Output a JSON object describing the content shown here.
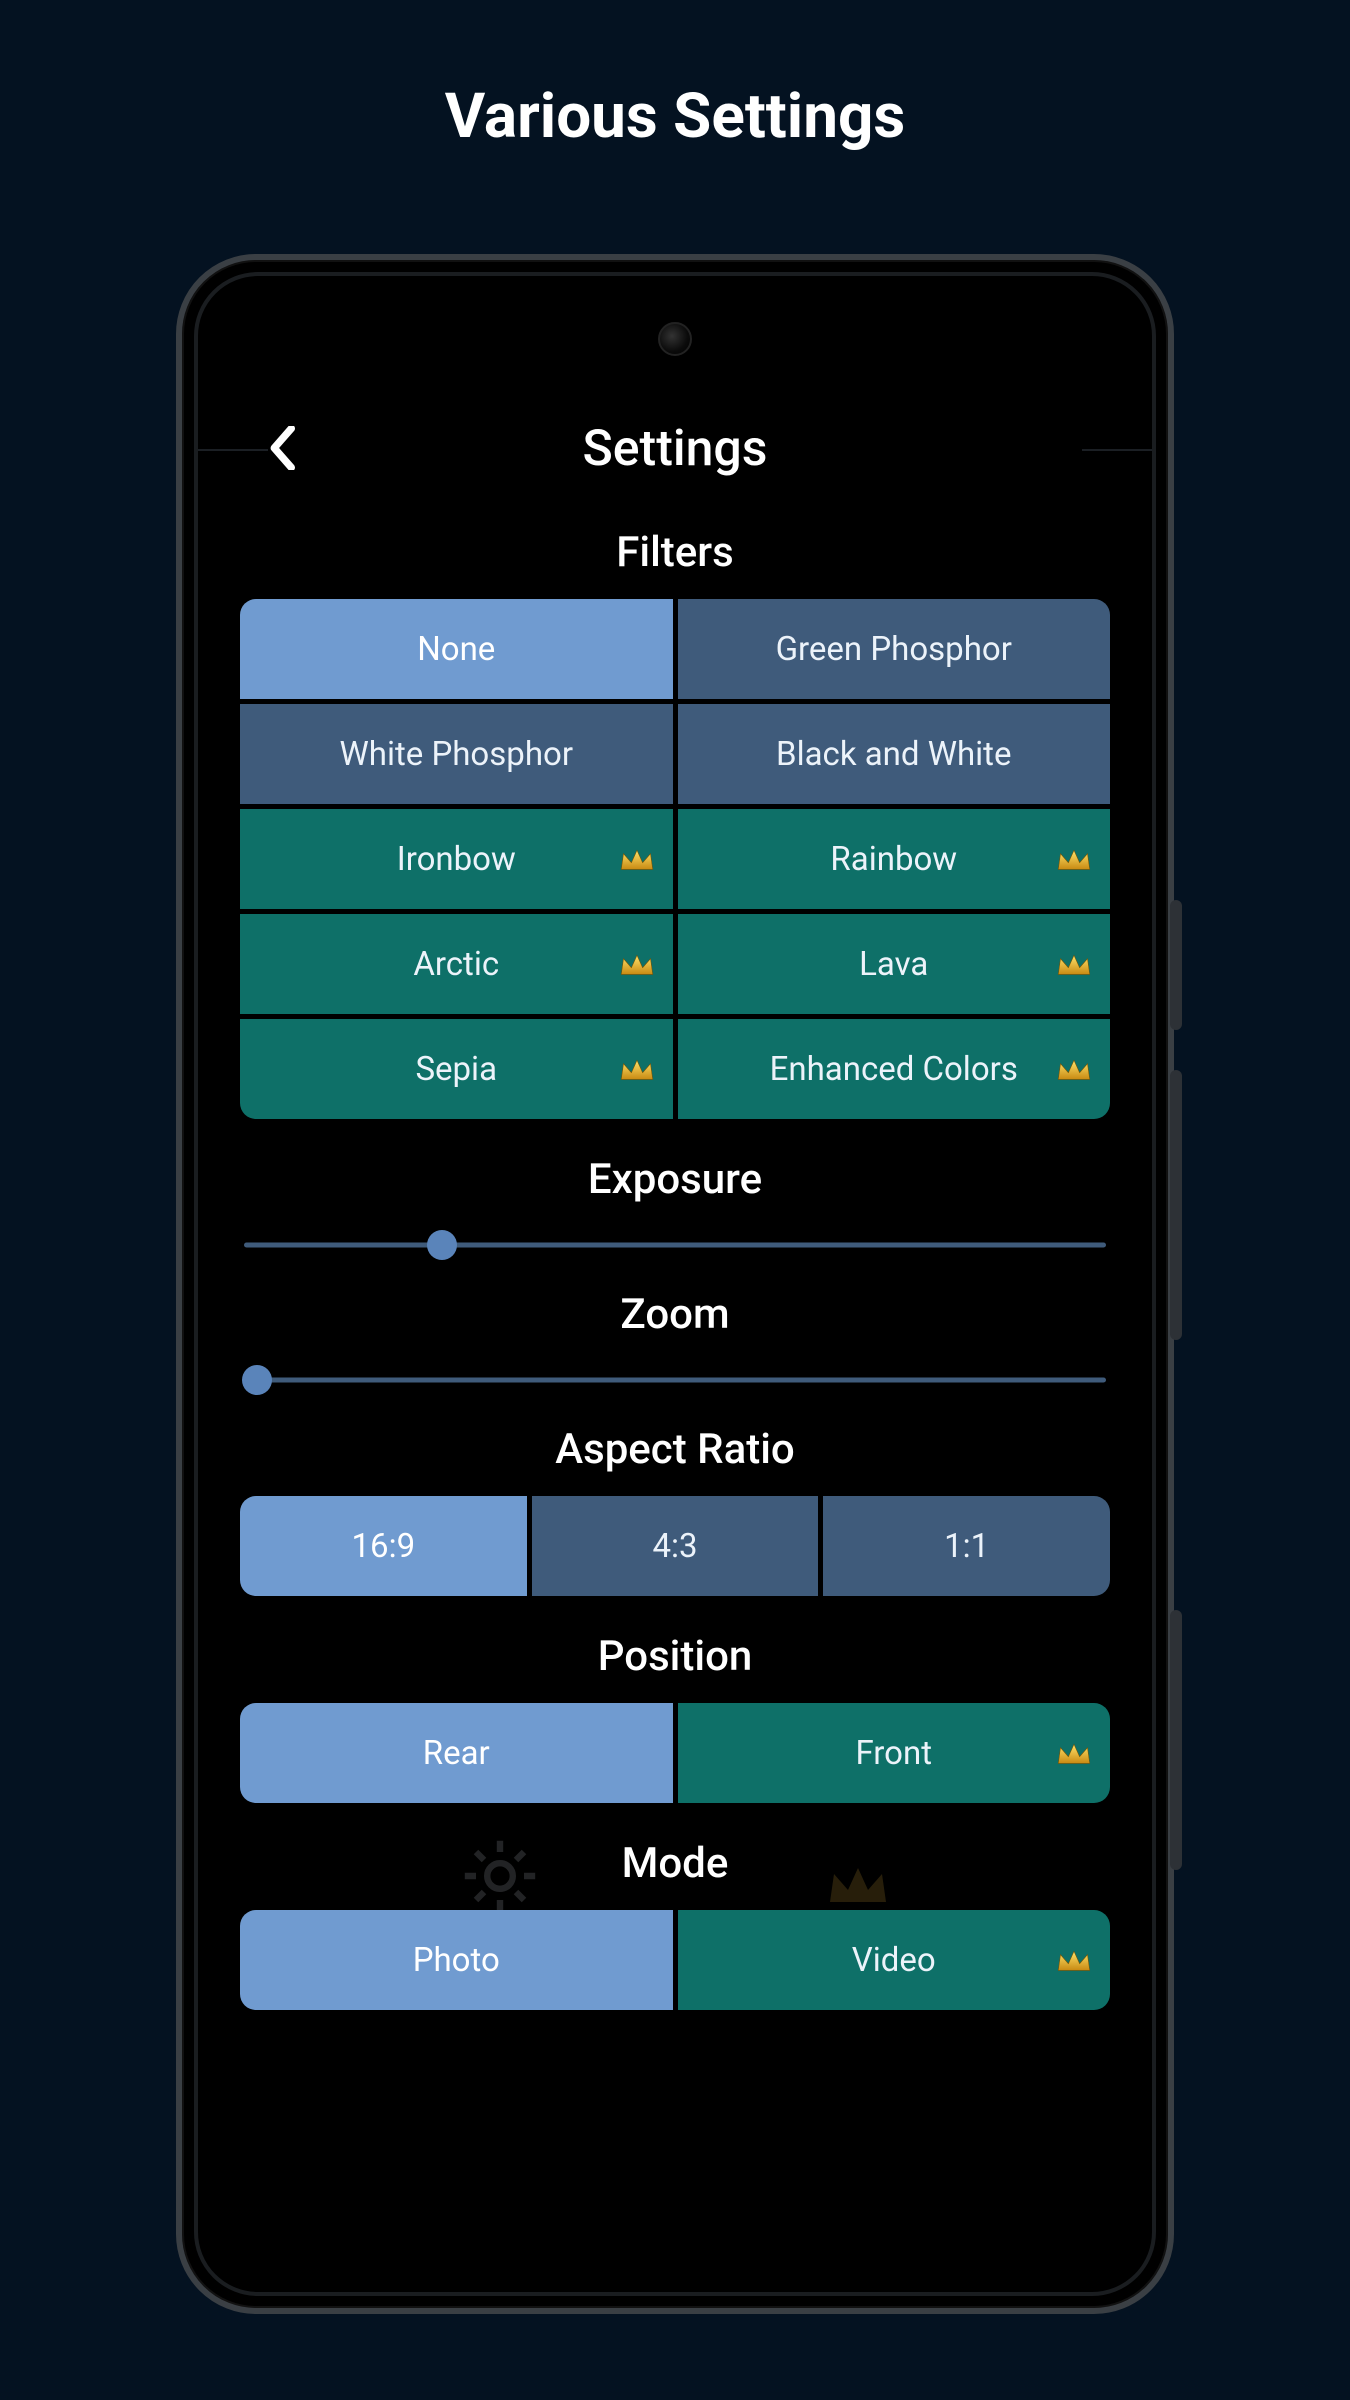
{
  "page_title": "Various Settings",
  "header": {
    "title": "Settings"
  },
  "filters": {
    "title": "Filters",
    "items": [
      {
        "label": "None",
        "state": "selected",
        "premium": false
      },
      {
        "label": "Green Phosphor",
        "state": "unselected",
        "premium": false
      },
      {
        "label": "White Phosphor",
        "state": "unselected",
        "premium": false
      },
      {
        "label": "Black and White",
        "state": "unselected",
        "premium": false
      },
      {
        "label": "Ironbow",
        "state": "premium",
        "premium": true
      },
      {
        "label": "Rainbow",
        "state": "premium",
        "premium": true
      },
      {
        "label": "Arctic",
        "state": "premium",
        "premium": true
      },
      {
        "label": "Lava",
        "state": "premium",
        "premium": true
      },
      {
        "label": "Sepia",
        "state": "premium",
        "premium": true
      },
      {
        "label": "Enhanced Colors",
        "state": "premium",
        "premium": true
      }
    ]
  },
  "exposure": {
    "title": "Exposure",
    "value_pct": 23
  },
  "zoom": {
    "title": "Zoom",
    "value_pct": 1.5
  },
  "aspect_ratio": {
    "title": "Aspect Ratio",
    "items": [
      {
        "label": "16:9",
        "state": "selected"
      },
      {
        "label": "4:3",
        "state": "unselected"
      },
      {
        "label": "1:1",
        "state": "unselected"
      }
    ]
  },
  "position": {
    "title": "Position",
    "items": [
      {
        "label": "Rear",
        "state": "selected",
        "premium": false
      },
      {
        "label": "Front",
        "state": "premium",
        "premium": true
      }
    ]
  },
  "mode": {
    "title": "Mode",
    "items": [
      {
        "label": "Photo",
        "state": "selected",
        "premium": false
      },
      {
        "label": "Video",
        "state": "premium",
        "premium": true
      }
    ]
  },
  "colors": {
    "selected": "#709bd0",
    "unselected": "#3f5b7b",
    "premium": "#0e7068",
    "bg": "#041221"
  }
}
